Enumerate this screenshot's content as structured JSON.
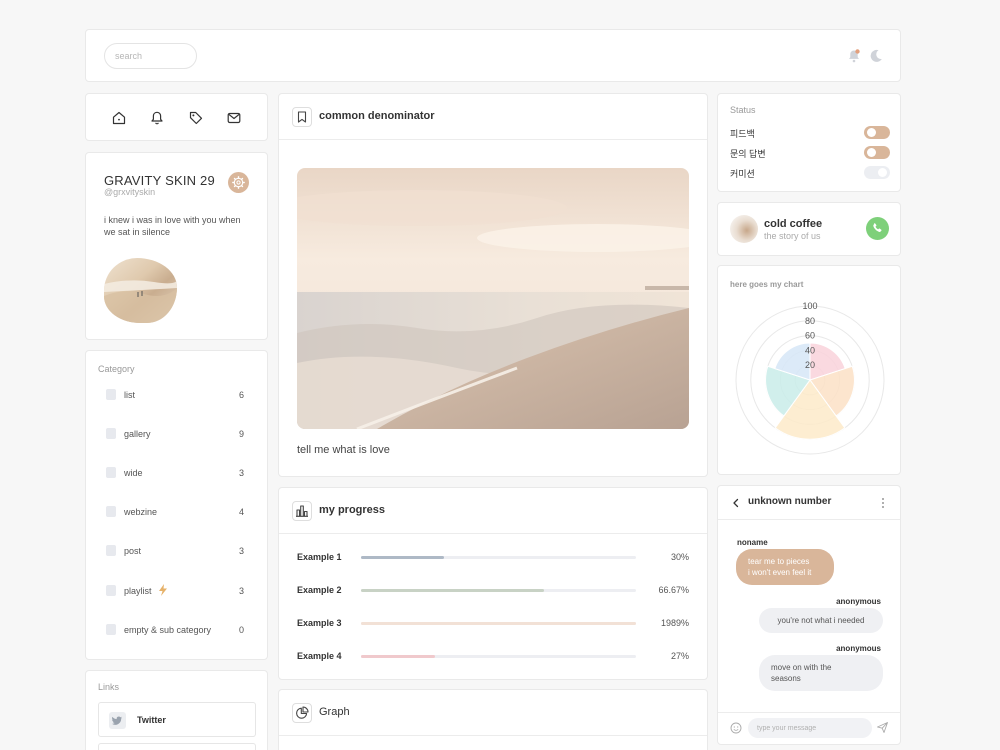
{
  "topbar": {
    "search_placeholder": "search",
    "icons": [
      "notification-icon",
      "moon-icon"
    ],
    "notification_dot_color": "#e3a07d"
  },
  "nav": {
    "icons": [
      "home-icon",
      "bell-icon",
      "tag-icon",
      "mail-icon"
    ]
  },
  "profile": {
    "name": "GRAVITY SKIN 29",
    "handle": "@grxvityskin",
    "bio": "i knew i was in love with you when we sat in silence",
    "accent_color": "#d9b69a"
  },
  "category": {
    "label": "Category",
    "items": [
      {
        "label": "list",
        "count": "6"
      },
      {
        "label": "gallery",
        "count": "9"
      },
      {
        "label": "wide",
        "count": "3"
      },
      {
        "label": "webzine",
        "count": "4"
      },
      {
        "label": "post",
        "count": "3"
      },
      {
        "label": "playlist",
        "count": "3"
      },
      {
        "label": "empty & sub category",
        "count": "0"
      }
    ]
  },
  "links": {
    "label": "Links",
    "items": [
      {
        "label": "Twitter",
        "icon": "twitter-icon"
      },
      {
        "label": "",
        "icon": "link-icon"
      }
    ]
  },
  "post": {
    "title": "common denominator",
    "caption": "tell me what is love"
  },
  "progress": {
    "title": "my progress",
    "items": [
      {
        "label": "Example 1",
        "value": "30%",
        "fill": 0.3,
        "color": "#aeb9c6"
      },
      {
        "label": "Example 2",
        "value": "66.67%",
        "fill": 0.6667,
        "color": "#c8d2c5"
      },
      {
        "label": "Example 3",
        "value": "1989%",
        "fill": 1.0,
        "color": "#f2e1d6"
      },
      {
        "label": "Example 4",
        "value": "27%",
        "fill": 0.27,
        "color": "#f0c9cc"
      }
    ]
  },
  "graph": {
    "title": "Graph"
  },
  "status": {
    "label": "Status",
    "items": [
      {
        "label": "피드백",
        "on": true
      },
      {
        "label": "문의 답변",
        "on": true
      },
      {
        "label": "커미션",
        "on": false
      }
    ],
    "on_color": "#d9b69a",
    "off_color": "#eceef2"
  },
  "music": {
    "title": "cold coffee",
    "subtitle": "the story of us"
  },
  "chart_data": {
    "type": "polar-area",
    "title": "here goes my chart",
    "ticks": [
      "100",
      "80",
      "60",
      "40",
      "20"
    ],
    "rmax": 100,
    "values": [
      50,
      60,
      80,
      60,
      50
    ],
    "colors": [
      "#f9d2da",
      "#fbe1c6",
      "#fdeac9",
      "#c9ece9",
      "#d6e6f7"
    ]
  },
  "chat": {
    "title": "unknown number",
    "messages": [
      {
        "sender": "noname",
        "lines": [
          "tear me to pieces",
          "i won't even feel it"
        ],
        "mine": true
      },
      {
        "sender": "anonymous",
        "lines": [
          "you're not what i needed"
        ],
        "mine": false
      },
      {
        "sender": "anonymous",
        "lines": [
          "move on with the",
          "seasons"
        ],
        "mine": false
      }
    ],
    "input_placeholder": "type your message"
  }
}
